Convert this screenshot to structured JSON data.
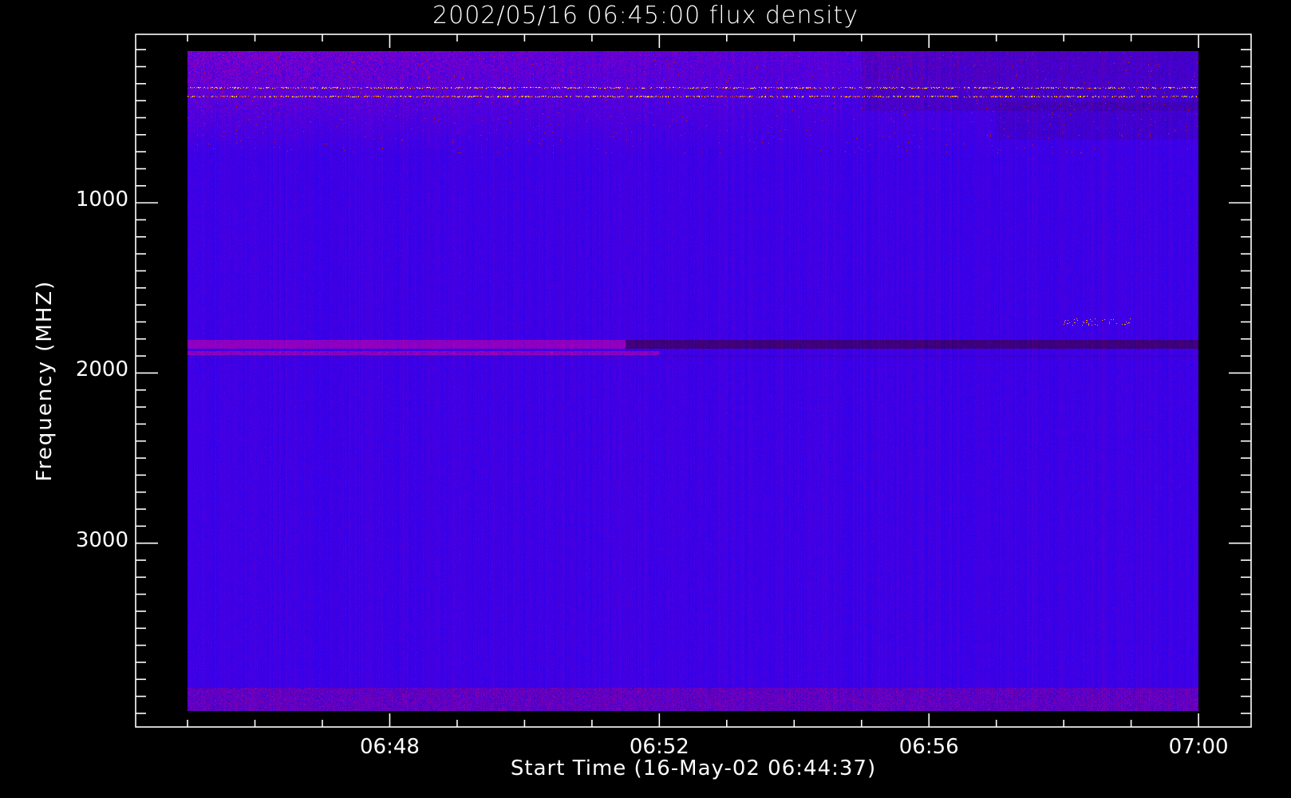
{
  "chart_data": {
    "type": "heatmap",
    "title": "2002/05/16 06:45:00 flux density",
    "xlabel": "Start Time (16-May-02 06:44:37)",
    "ylabel": "Frequency (MHZ)",
    "x_unit": "minutes after 06:00 UT",
    "xlim": [
      44.23,
      60.78
    ],
    "x_data_range": [
      45,
      60
    ],
    "x_major_ticks": [
      {
        "value": 48,
        "label": "06:48"
      },
      {
        "value": 52,
        "label": "06:52"
      },
      {
        "value": 56,
        "label": "06:56"
      },
      {
        "value": 60,
        "label": "07:00"
      }
    ],
    "x_minor_step": 1,
    "ylim": [
      4080,
      10
    ],
    "y_reversed": true,
    "y_data_range": [
      100,
      4000
    ],
    "y_major_ticks": [
      {
        "value": 1000,
        "label": "1000"
      },
      {
        "value": 2000,
        "label": "2000"
      },
      {
        "value": 3000,
        "label": "3000"
      }
    ],
    "y_minor_step": 100,
    "colormap": [
      "#000080",
      "#2400f0",
      "#7a0090",
      "#d01000",
      "#ff9000",
      "#ffff90"
    ],
    "background_color": "#2a00ee",
    "features": [
      {
        "kind": "noisy-low-freq-emission",
        "freq": [
          100,
          700
        ],
        "time": [
          45,
          60
        ],
        "intensity_decreasing_with_time": true
      },
      {
        "kind": "bright-interference-line",
        "freq": 316,
        "time": [
          45,
          60
        ]
      },
      {
        "kind": "bright-interference-line",
        "freq": 367,
        "time": [
          45,
          60
        ]
      },
      {
        "kind": "band-enhanced-then-depressed",
        "freq": [
          1806,
          1858
        ],
        "switch_time": 51.5
      },
      {
        "kind": "band-enhanced",
        "freq": [
          1875,
          1895
        ],
        "time": [
          45,
          52
        ]
      },
      {
        "kind": "burst",
        "freq": [
          1680,
          1720
        ],
        "time": [
          58,
          59
        ]
      },
      {
        "kind": "noisy-high-freq-band",
        "freq": [
          3865,
          4000
        ],
        "time": [
          45,
          60
        ]
      }
    ]
  }
}
